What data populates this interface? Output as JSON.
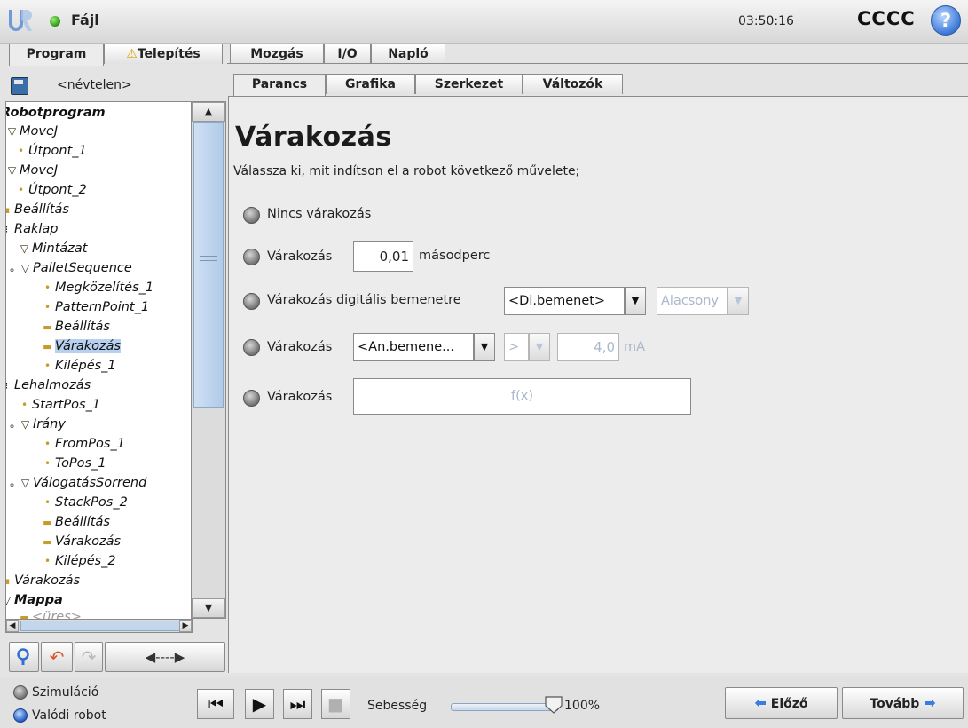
{
  "topbar": {
    "menu_label": "Fájl",
    "clock": "03:50:16",
    "robot_name": "CCCC",
    "help_label": "?"
  },
  "main_tabs": [
    {
      "label": "Program",
      "active": true
    },
    {
      "label": "Telepítés",
      "warning": true
    },
    {
      "label": "Mozgás"
    },
    {
      "label": "I/O"
    },
    {
      "label": "Napló"
    }
  ],
  "program_name": "<névtelen>",
  "tree": [
    {
      "label": "Robotprogram"
    },
    {
      "label": "MoveJ"
    },
    {
      "label": "Útpont_1"
    },
    {
      "label": "MoveJ"
    },
    {
      "label": "Útpont_2"
    },
    {
      "label": "Beállítás"
    },
    {
      "label": "Raklap"
    },
    {
      "label": "Mintázat"
    },
    {
      "label": "PalletSequence"
    },
    {
      "label": "Megközelítés_1"
    },
    {
      "label": "PatternPoint_1"
    },
    {
      "label": "Beállítás"
    },
    {
      "label": "Várakozás"
    },
    {
      "label": "Kilépés_1"
    },
    {
      "label": "Lehalmozás"
    },
    {
      "label": "StartPos_1"
    },
    {
      "label": "Irány"
    },
    {
      "label": "FromPos_1"
    },
    {
      "label": "ToPos_1"
    },
    {
      "label": "VálogatásSorrend"
    },
    {
      "label": "StackPos_2"
    },
    {
      "label": "Beállítás"
    },
    {
      "label": "Várakozás"
    },
    {
      "label": "Kilépés_2"
    },
    {
      "label": "Várakozás"
    },
    {
      "label": "Mappa"
    },
    {
      "label": "<üres>"
    }
  ],
  "sub_tabs": [
    {
      "label": "Parancs",
      "active": true
    },
    {
      "label": "Grafika"
    },
    {
      "label": "Szerkezet"
    },
    {
      "label": "Változók"
    }
  ],
  "wait": {
    "title": "Várakozás",
    "description": "Válassza ki, mit indítson el a robot következő művelete;",
    "opt_none": "Nincs várakozás",
    "opt_time_label": "Várakozás",
    "time_value": "0,01",
    "time_unit": "másodperc",
    "opt_digital_label": "Várakozás digitális bemenetre",
    "digital_input": "<Di.bemenet>",
    "digital_level": "Alacsony",
    "opt_analog_label": "Várakozás",
    "analog_input": "<An.bemene...",
    "analog_compare": ">",
    "analog_value": "4,0",
    "analog_unit": "mA",
    "opt_expr_label": "Várakozás",
    "expr_placeholder": "f(x)"
  },
  "bottom": {
    "sim_label": "Szimuláció",
    "real_label": "Valódi robot",
    "speed_label": "Sebesség",
    "speed_value": "100%",
    "speed_fraction": 1.0,
    "prev_label": "Előző",
    "next_label": "Tovább"
  },
  "colors": {
    "selection": "#b7d0ee",
    "tree_glyph": "#c79a2a",
    "help_blue": "#3d78d8",
    "status_green": "#2d9b14"
  }
}
